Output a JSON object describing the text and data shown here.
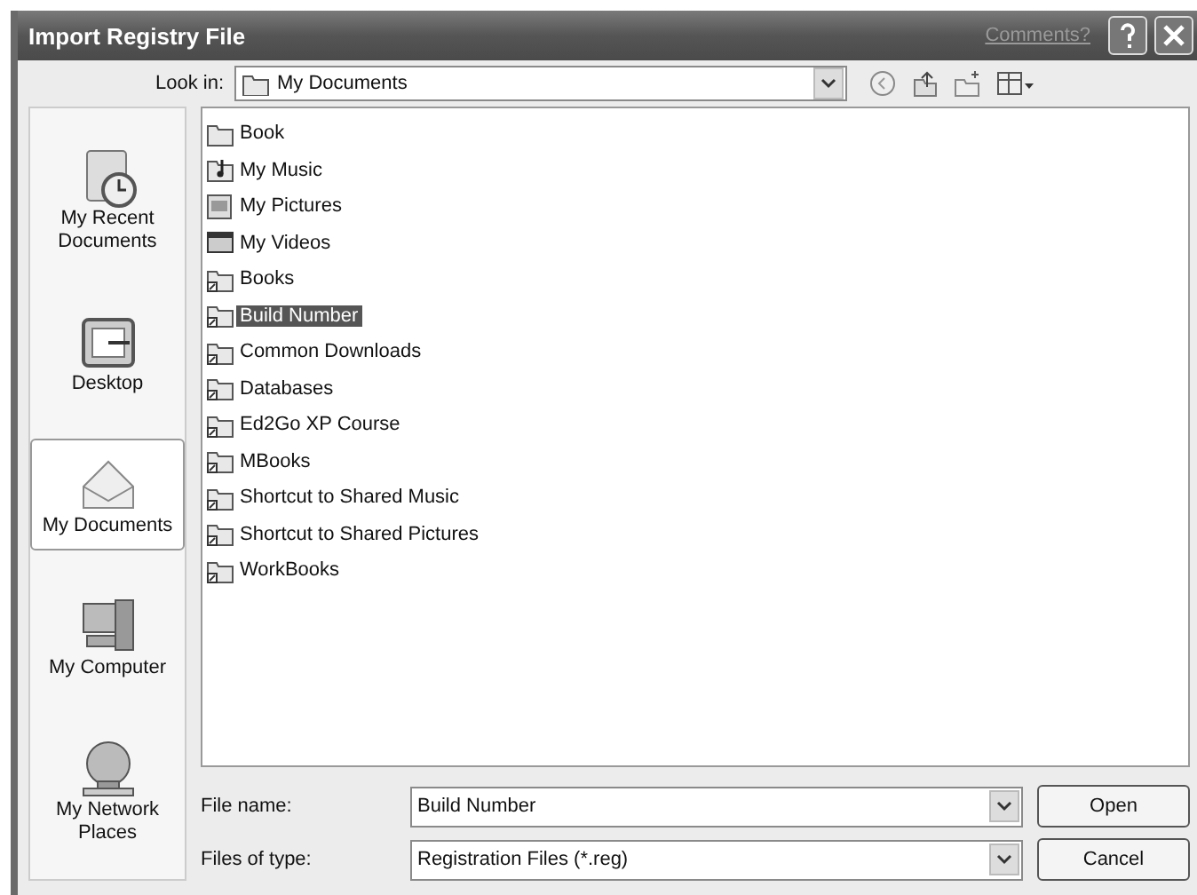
{
  "window": {
    "title": "Import Registry File",
    "comments_link": "Comments?"
  },
  "look_in": {
    "label": "Look in:",
    "value": "My Documents"
  },
  "places": [
    {
      "label": "My Recent Documents",
      "kind": "recent",
      "selected": false
    },
    {
      "label": "Desktop",
      "kind": "desktop",
      "selected": false
    },
    {
      "label": "My Documents",
      "kind": "documents",
      "selected": true
    },
    {
      "label": "My Computer",
      "kind": "computer",
      "selected": false
    },
    {
      "label": "My Network Places",
      "kind": "network",
      "selected": false
    }
  ],
  "files": [
    {
      "name": "Book",
      "kind": "folder",
      "selected": false
    },
    {
      "name": "My Music",
      "kind": "music",
      "selected": false
    },
    {
      "name": "My Pictures",
      "kind": "pictures",
      "selected": false
    },
    {
      "name": "My Videos",
      "kind": "videos",
      "selected": false
    },
    {
      "name": "Books",
      "kind": "shared",
      "selected": false
    },
    {
      "name": "Build Number",
      "kind": "shared",
      "selected": true
    },
    {
      "name": "Common Downloads",
      "kind": "shared",
      "selected": false
    },
    {
      "name": "Databases",
      "kind": "shared",
      "selected": false
    },
    {
      "name": "Ed2Go XP Course",
      "kind": "shared",
      "selected": false
    },
    {
      "name": "MBooks",
      "kind": "shared",
      "selected": false
    },
    {
      "name": "Shortcut to Shared Music",
      "kind": "shared",
      "selected": false
    },
    {
      "name": "Shortcut to Shared Pictures",
      "kind": "shared",
      "selected": false
    },
    {
      "name": "WorkBooks",
      "kind": "shared",
      "selected": false
    }
  ],
  "file_name": {
    "label": "File name:",
    "value": "Build Number"
  },
  "file_type": {
    "label": "Files of type:",
    "value": "Registration Files (*.reg)"
  },
  "buttons": [
    "Open",
    "Cancel"
  ]
}
